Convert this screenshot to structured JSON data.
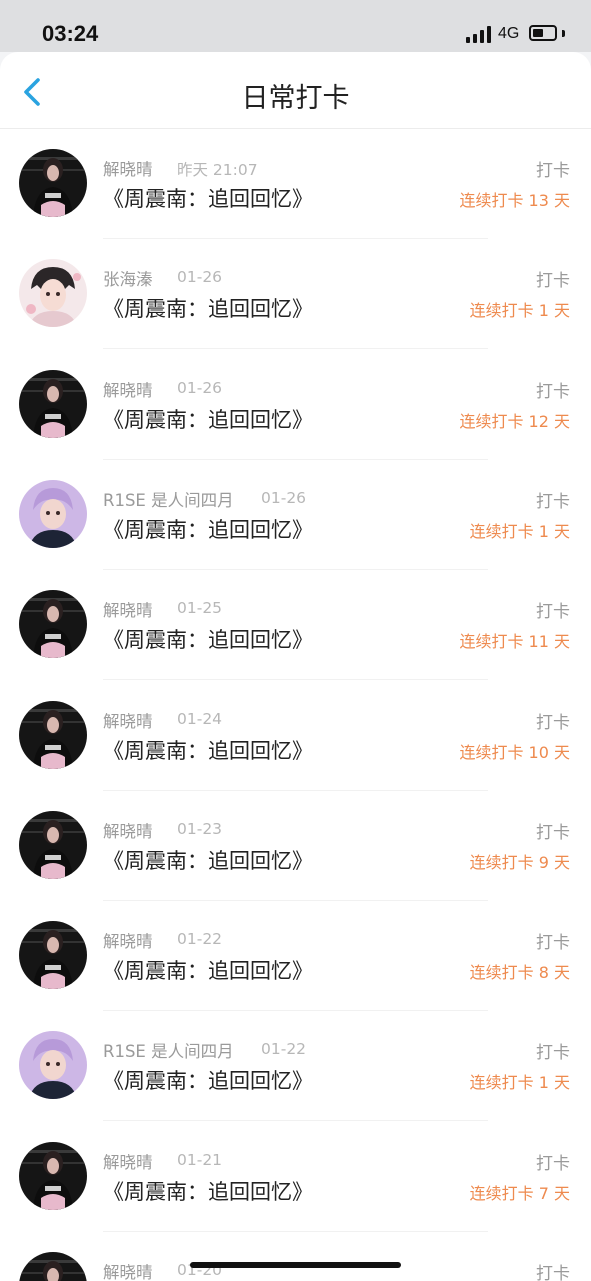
{
  "status": {
    "time": "03:24",
    "network": "4G"
  },
  "nav": {
    "title": "日常打卡"
  },
  "entries": [
    {
      "name": "解晓晴",
      "date": "昨天 21:07",
      "title": "《周震南：追回回忆》",
      "action": "打卡",
      "streak": "连续打卡 13 天",
      "avatar": "dark-avatar-icon"
    },
    {
      "name": "张海溱",
      "date": "01-26",
      "title": "《周震南：追回回忆》",
      "action": "打卡",
      "streak": "连续打卡 1 天",
      "avatar": "anime-avatar-icon"
    },
    {
      "name": "解晓晴",
      "date": "01-26",
      "title": "《周震南：追回回忆》",
      "action": "打卡",
      "streak": "连续打卡 12 天",
      "avatar": "dark-avatar-icon"
    },
    {
      "name": "R1SE 是人间四月",
      "date": "01-26",
      "title": "《周震南：追回回忆》",
      "action": "打卡",
      "streak": "连续打卡 1 天",
      "avatar": "purple-avatar-icon"
    },
    {
      "name": "解晓晴",
      "date": "01-25",
      "title": "《周震南：追回回忆》",
      "action": "打卡",
      "streak": "连续打卡 11 天",
      "avatar": "dark-avatar-icon"
    },
    {
      "name": "解晓晴",
      "date": "01-24",
      "title": "《周震南：追回回忆》",
      "action": "打卡",
      "streak": "连续打卡 10 天",
      "avatar": "dark-avatar-icon"
    },
    {
      "name": "解晓晴",
      "date": "01-23",
      "title": "《周震南：追回回忆》",
      "action": "打卡",
      "streak": "连续打卡 9 天",
      "avatar": "dark-avatar-icon"
    },
    {
      "name": "解晓晴",
      "date": "01-22",
      "title": "《周震南：追回回忆》",
      "action": "打卡",
      "streak": "连续打卡 8 天",
      "avatar": "dark-avatar-icon"
    },
    {
      "name": "R1SE 是人间四月",
      "date": "01-22",
      "title": "《周震南：追回回忆》",
      "action": "打卡",
      "streak": "连续打卡 1 天",
      "avatar": "purple-avatar-icon"
    },
    {
      "name": "解晓晴",
      "date": "01-21",
      "title": "《周震南：追回回忆》",
      "action": "打卡",
      "streak": "连续打卡 7 天",
      "avatar": "dark-avatar-icon"
    },
    {
      "name": "解晓晴",
      "date": "01-20",
      "title": "",
      "action": "打卡",
      "streak": "",
      "avatar": "dark-avatar-icon"
    }
  ],
  "colors": {
    "accent": "#2aa3e0",
    "streak": "#ee8a4e",
    "muted": "#9a9a9a"
  }
}
